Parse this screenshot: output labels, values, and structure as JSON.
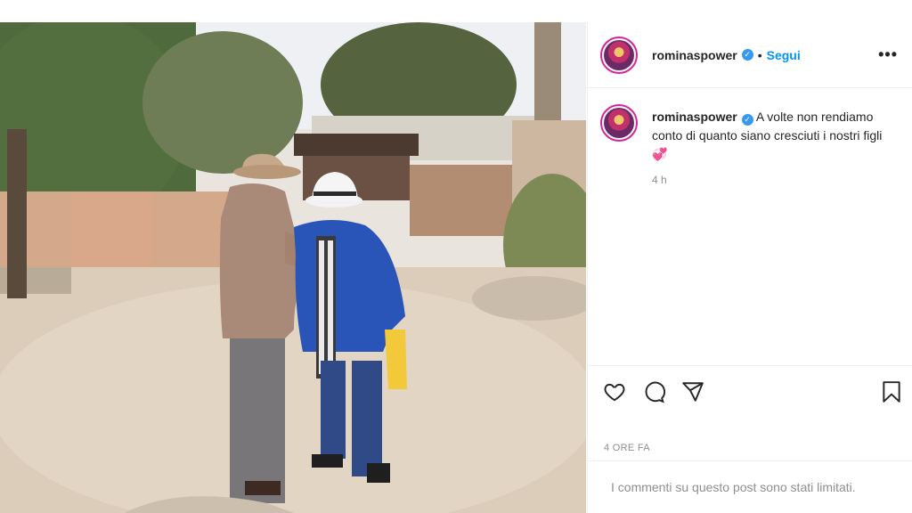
{
  "post": {
    "username": "rominaspower",
    "verified_mark": "✓",
    "separator": "•",
    "follow_label": "Segui",
    "more_label": "•••",
    "caption_text": "A volte non rendiamo conto di quanto siano cresciuti i nostri figli",
    "caption_emoji": "💞",
    "caption_time": "4 h",
    "date_label": "4 ORE FA",
    "comments_notice": "I commenti su questo post sono stati limitati."
  },
  "icons": {
    "like": "heart-icon",
    "comment": "comment-icon",
    "share": "paper-plane-icon",
    "save": "bookmark-icon",
    "more": "more-options-icon"
  },
  "colors": {
    "follow": "#0095f6",
    "verified": "#3897f0",
    "avatar_ring": "#d6249f",
    "muted_text": "#8e8e8e"
  }
}
